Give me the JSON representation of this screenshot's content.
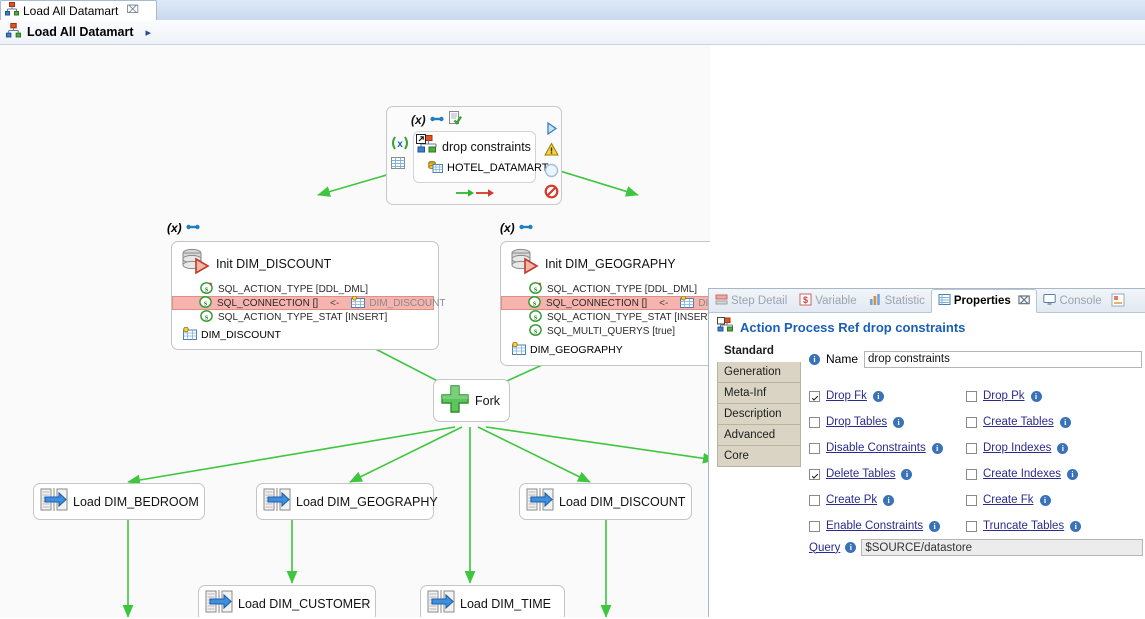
{
  "editor": {
    "tab_label": "Load All Datamart",
    "tab_close": "⌧",
    "icon": "process-diagram-icon"
  },
  "breadcrumb": {
    "label": "Load All Datamart",
    "arrow": "▸",
    "icon": "process-diagram-icon"
  },
  "diagram": {
    "root": {
      "title": "drop constraints",
      "datastore": "HOTEL_DATAMART",
      "badges": [
        "(x)",
        "link-icon",
        "checked-doc-icon"
      ],
      "side_icons": [
        "run-icon",
        "warning-icon",
        "disabled-circle-icon",
        "forbidden-icon"
      ],
      "left_icons": [
        "variables-icon",
        "grid-icon"
      ],
      "footer_icons": [
        "green-arrow",
        "red-arrow"
      ]
    },
    "init_discount": {
      "badge": "(x)",
      "title": "Init DIM_DISCOUNT",
      "attrs": [
        {
          "name": "SQL_ACTION_TYPE [DDL_DML]",
          "highlight": false,
          "star": true
        },
        {
          "name": "SQL_CONNECTION []",
          "link": "<-",
          "target": "DIM_DISCOUNT",
          "highlight": true,
          "star": false
        },
        {
          "name": "SQL_ACTION_TYPE_STAT [INSERT]",
          "highlight": false,
          "star": false
        }
      ],
      "datastore": "DIM_DISCOUNT"
    },
    "init_geography": {
      "badge": "(x)",
      "title": "Init DIM_GEOGRAPHY",
      "attrs": [
        {
          "name": "SQL_ACTION_TYPE [DDL_DML]",
          "highlight": false,
          "star": true
        },
        {
          "name": "SQL_CONNECTION []",
          "link": "<-",
          "target": "DIM_GEOGRAPHY",
          "highlight": true,
          "star": false
        },
        {
          "name": "SQL_ACTION_TYPE_STAT [INSERT]",
          "highlight": false,
          "star": false
        },
        {
          "name": "SQL_MULTI_QUERYS [true]",
          "highlight": false,
          "star": false
        }
      ],
      "datastore": "DIM_GEOGRAPHY"
    },
    "fork": {
      "title": "Fork",
      "icon": "green-plus-icon"
    },
    "loads": [
      {
        "title": "Load DIM_BEDROOM"
      },
      {
        "title": "Load DIM_GEOGRAPHY"
      },
      {
        "title": "Load DIM_DISCOUNT"
      },
      {
        "title": "Load DIM_CUSTOMER"
      },
      {
        "title": "Load DIM_TIME"
      }
    ],
    "edge_color": "#3ec63e"
  },
  "properties_view": {
    "tabs": [
      {
        "label": "Step Detail",
        "icon": "step-detail-icon",
        "active": false,
        "closable": false
      },
      {
        "label": "Variable",
        "icon": "variable-icon",
        "active": false,
        "closable": false
      },
      {
        "label": "Statistic",
        "icon": "statistic-icon",
        "active": false,
        "closable": false
      },
      {
        "label": "Properties",
        "icon": "properties-icon",
        "active": true,
        "closable": true
      },
      {
        "label": "Console",
        "icon": "console-icon",
        "active": false,
        "closable": false
      }
    ],
    "tab_close": "⌧",
    "header": {
      "icon": "action-process-ref-icon",
      "title": "Action Process Ref drop constraints",
      "color": "#1a5fb4"
    },
    "left_tabs": [
      {
        "label": "Standard",
        "active": true
      },
      {
        "label": "Generation",
        "active": false
      },
      {
        "label": "Meta-Inf",
        "active": false
      },
      {
        "label": "Description",
        "active": false
      },
      {
        "label": "Advanced",
        "active": false
      },
      {
        "label": "Core",
        "active": false
      }
    ],
    "name_field": {
      "label": "Name",
      "value": "drop constraints",
      "placeholder": ""
    },
    "checkboxes": [
      {
        "label": "Drop Fk",
        "checked": true
      },
      {
        "label": "Drop Pk",
        "checked": false
      },
      {
        "label": "Drop Tables",
        "checked": false
      },
      {
        "label": "Create Tables",
        "checked": false
      },
      {
        "label": "Disable Constraints",
        "checked": false
      },
      {
        "label": "Drop Indexes",
        "checked": false
      },
      {
        "label": "Delete Tables",
        "checked": true
      },
      {
        "label": "Create Indexes",
        "checked": false
      },
      {
        "label": "Create Pk",
        "checked": false
      },
      {
        "label": "Create Fk",
        "checked": false
      },
      {
        "label": "Enable Constraints",
        "checked": false
      },
      {
        "label": "Truncate Tables",
        "checked": false
      }
    ],
    "query_field": {
      "label": "Query",
      "value": "$SOURCE/datastore",
      "placeholder": ""
    },
    "info_glyph": "i"
  }
}
